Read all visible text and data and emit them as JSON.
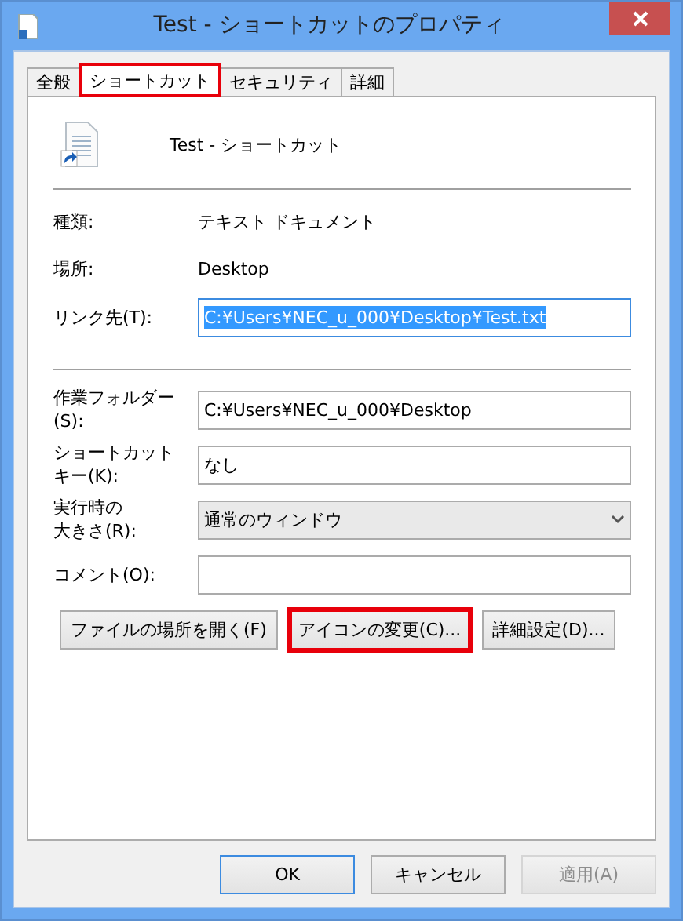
{
  "window": {
    "title": "Test - ショートカットのプロパティ"
  },
  "tabs": [
    {
      "label": "全般",
      "selected": false,
      "highlighted": false
    },
    {
      "label": "ショートカット",
      "selected": true,
      "highlighted": true
    },
    {
      "label": "セキュリティ",
      "selected": false,
      "highlighted": false
    },
    {
      "label": "詳細",
      "selected": false,
      "highlighted": false
    }
  ],
  "header": {
    "name": "Test - ショートカット"
  },
  "info": [
    {
      "label": "種類:",
      "value": "テキスト ドキュメント"
    },
    {
      "label": "場所:",
      "value": "Desktop"
    }
  ],
  "target": {
    "label": "リンク先(T):",
    "value": "C:¥Users¥NEC_u_000¥Desktop¥Test.txt",
    "selected": true
  },
  "fields": [
    {
      "kind": "text",
      "label_lines": [
        "作業フォルダー",
        "(S):"
      ],
      "value": "C:¥Users¥NEC_u_000¥Desktop"
    },
    {
      "kind": "text",
      "label_lines": [
        "ショートカット",
        "キー(K):"
      ],
      "value": "なし"
    },
    {
      "kind": "select",
      "label_lines": [
        "実行時の",
        "大きさ(R):"
      ],
      "value": "通常のウィンドウ"
    },
    {
      "kind": "text",
      "label_lines": [
        "コメント(O):"
      ]
    }
  ],
  "actions": [
    {
      "label": "ファイルの場所を開く(F)",
      "highlighted": false
    },
    {
      "label": "アイコンの変更(C)...",
      "highlighted": true
    },
    {
      "label": "詳細設定(D)...",
      "highlighted": false
    }
  ],
  "footer": [
    {
      "label": "OK",
      "default": true,
      "disabled": false
    },
    {
      "label": "キャンセル",
      "default": false,
      "disabled": false
    },
    {
      "label": "適用(A)",
      "default": false,
      "disabled": true
    }
  ]
}
